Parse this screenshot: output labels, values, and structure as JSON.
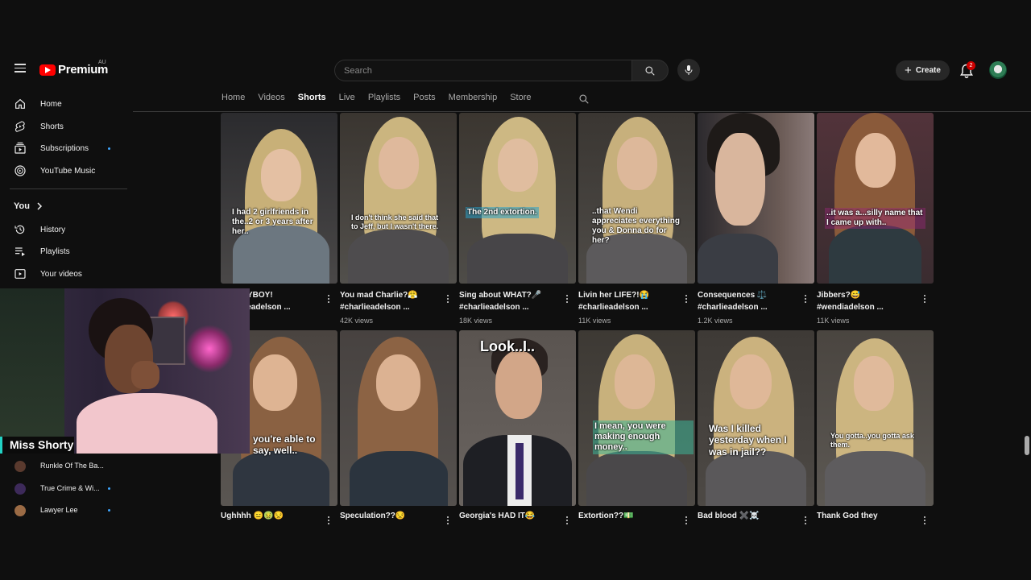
{
  "header": {
    "logo_text": "Premium",
    "logo_region": "AU",
    "search_placeholder": "Search",
    "create_label": "Create",
    "notification_count": "2"
  },
  "sidebar": {
    "items": [
      {
        "label": "Home",
        "icon": "home-icon"
      },
      {
        "label": "Shorts",
        "icon": "shorts-icon"
      },
      {
        "label": "Subscriptions",
        "icon": "subscriptions-icon"
      },
      {
        "label": "YouTube Music",
        "icon": "youtube-music-icon"
      }
    ],
    "you_heading": "You",
    "you_items": [
      {
        "label": "History",
        "icon": "history-icon"
      },
      {
        "label": "Playlists",
        "icon": "playlists-icon"
      },
      {
        "label": "Your videos",
        "icon": "your-videos-icon"
      }
    ],
    "subscriptions": [
      {
        "name": "Runkle Of The Ba...",
        "avatar_color": "#5a3a2e"
      },
      {
        "name": "True Crime & Wi...",
        "avatar_color": "#3d2a5a"
      },
      {
        "name": "Lawyer Lee",
        "avatar_color": "#9b6b45"
      }
    ]
  },
  "tabs": [
    "Home",
    "Videos",
    "Shorts",
    "Live",
    "Playlists",
    "Posts",
    "Membership",
    "Store"
  ],
  "active_tab": "Shorts",
  "webcam": {
    "label": "Miss Shorty"
  },
  "shorts_row1": [
    {
      "title": "I had the PLAYBOY!",
      "tag": "#charlieadelson ...",
      "views": "...",
      "caption": "I had 2 girlfriends in the..2 or 3 years after her.."
    },
    {
      "title": "You mad Charlie?😤",
      "tag": "#charlieadelson ...",
      "views": "42K views",
      "caption": "I don't think she said that to Jeff, but I wasn't there."
    },
    {
      "title": "Sing about WHAT?🎤",
      "tag": "#charlieadelson ...",
      "views": "18K views",
      "caption": "The 2nd extortion."
    },
    {
      "title": "Livin her LIFE?!😭",
      "tag": "#charlieadelson ...",
      "views": "11K views",
      "caption": "..that Wendi appreciates everything you & Donna do for her?"
    },
    {
      "title": "Consequences ⚖️",
      "tag": "#charlieadelson ...",
      "views": "1.2K views",
      "caption": ""
    },
    {
      "title": "Jibbers?😅",
      "tag": "#wendiadelson ...",
      "views": "11K views",
      "caption": "..it was a...silly name that I came up with.."
    }
  ],
  "shorts_row2": [
    {
      "title": "Ughhhh 😑🤢😒",
      "caption": "you're able to say, well.."
    },
    {
      "title": "Speculation??😒",
      "caption": ""
    },
    {
      "title": "Georgia's HAD IT😂",
      "caption": "Look..I.."
    },
    {
      "title": "Extortion??💵",
      "caption": "I mean, you were making enough money.."
    },
    {
      "title": "Bad blood ✖️☠️",
      "caption": "Was I killed yesterday when I was in jail??"
    },
    {
      "title": "Thank God they",
      "caption": "You gotta..you gotta ask them."
    }
  ]
}
